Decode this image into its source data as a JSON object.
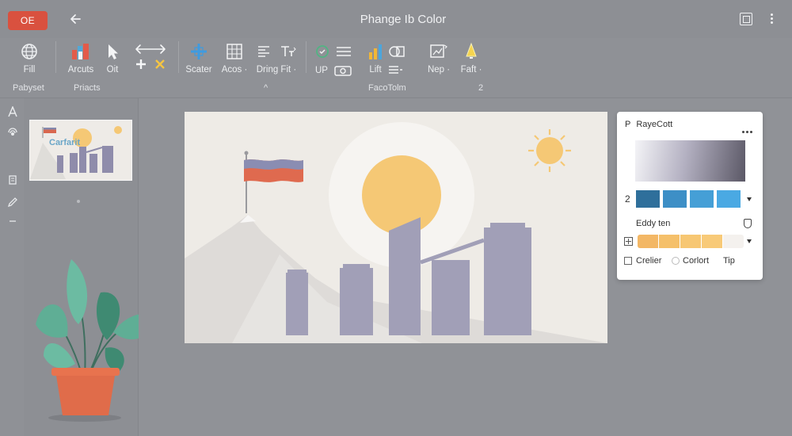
{
  "app": {
    "badge": "OE",
    "title": "Phange Ib Color"
  },
  "ribbon": {
    "buttons": [
      {
        "id": "fill",
        "label": "Fill"
      },
      {
        "id": "arcuts",
        "label": "Arcuts"
      },
      {
        "id": "oit",
        "label": "Oit"
      },
      {
        "id": "scater",
        "label": "Scater"
      },
      {
        "id": "acos",
        "label": "Acos ·"
      },
      {
        "id": "dring",
        "label": "Dring Fit ·"
      },
      {
        "id": "up",
        "label": "UP"
      },
      {
        "id": "lift",
        "label": "Lift"
      },
      {
        "id": "nep",
        "label": "Nep ·"
      },
      {
        "id": "faft",
        "label": "Faft ·"
      }
    ],
    "groups": {
      "g1": "Pabyset",
      "g2": "Priacts",
      "g3": "FacoTolm",
      "expand1": "^",
      "expand2": "2"
    }
  },
  "thumbnail": {
    "label": "Carfarit"
  },
  "panel": {
    "icon_letter": "P",
    "title": "RayeCott",
    "swatch_number": "2",
    "section_label": "Eddy ten",
    "options": {
      "opt1": "Crelier",
      "opt2": "Corlort",
      "opt3": "Tip"
    },
    "blue_swatches": [
      "#2f6f9b",
      "#3d8fc6",
      "#459fd6",
      "#4aa9e3"
    ],
    "yellow_swatches": [
      "#f3b765",
      "#f5c06a",
      "#f7c773",
      "#f8ca78",
      "#f4f1ee"
    ],
    "gradient_colors": [
      "#f4f4f7",
      "#b4b1c2",
      "#5b5866"
    ]
  },
  "colors": {
    "accent_red": "#d9513f",
    "bar_purple": "#a19fb7",
    "sun_yellow": "#f5c875",
    "pot_orange": "#e06c4a",
    "leaf_green": "#4f9d83"
  }
}
